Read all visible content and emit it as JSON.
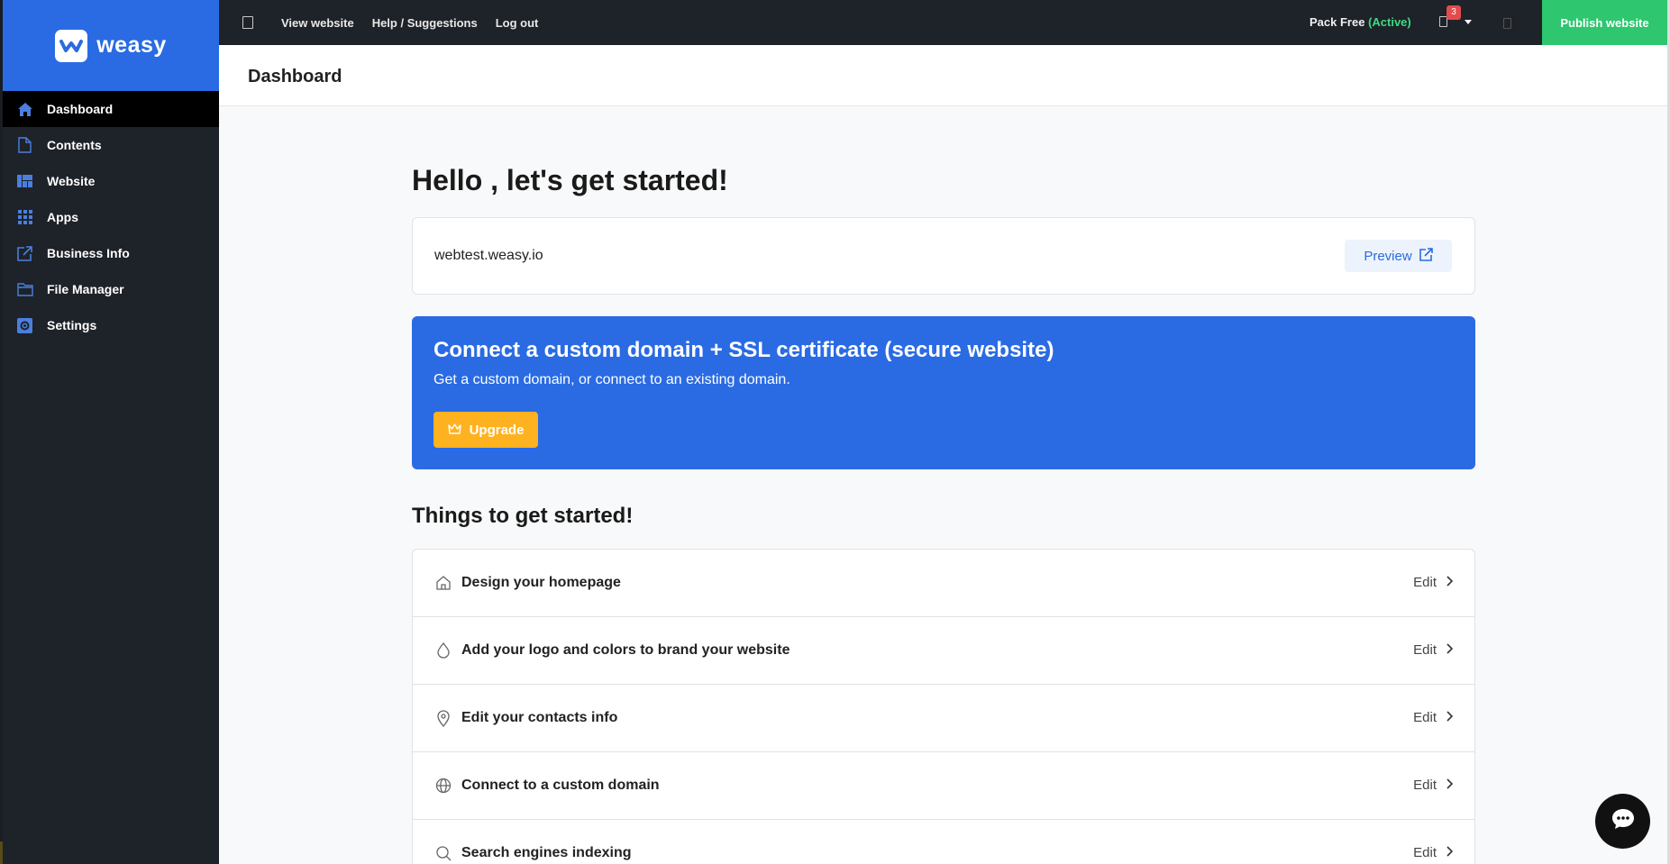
{
  "brand": {
    "name": "weasy",
    "color": "#2a6be3"
  },
  "sidebar": {
    "items": [
      {
        "label": "Dashboard",
        "icon": "home-icon",
        "active": true
      },
      {
        "label": "Contents",
        "icon": "document-icon"
      },
      {
        "label": "Website",
        "icon": "layout-icon"
      },
      {
        "label": "Apps",
        "icon": "grid-icon"
      },
      {
        "label": "Business Info",
        "icon": "external-edit-icon"
      },
      {
        "label": "File Manager",
        "icon": "folder-icon"
      },
      {
        "label": "Settings",
        "icon": "gear-icon"
      }
    ]
  },
  "topbar": {
    "links": [
      "View website",
      "Help / Suggestions",
      "Log out"
    ],
    "pack_label": "Pack Free",
    "pack_status": "(Active)",
    "notification_count": "3",
    "publish_label": "Publish website"
  },
  "page": {
    "title": "Dashboard"
  },
  "main": {
    "greeting": "Hello , let's get started!",
    "site_url": "webtest.weasy.io",
    "preview_label": "Preview",
    "promo": {
      "title": "Connect a custom domain + SSL certificate (secure website)",
      "subtitle": "Get a custom domain, or connect to an existing domain.",
      "button_label": "Upgrade"
    },
    "section_title": "Things to get started!",
    "tasks": [
      {
        "label": "Design your homepage",
        "icon": "home-outline-icon",
        "action": "Edit"
      },
      {
        "label": "Add your logo and colors to brand your website",
        "icon": "drop-icon",
        "action": "Edit"
      },
      {
        "label": "Edit your contacts info",
        "icon": "map-pin-icon",
        "action": "Edit"
      },
      {
        "label": "Connect to a custom domain",
        "icon": "globe-icon",
        "action": "Edit"
      },
      {
        "label": "Search engines indexing",
        "icon": "search-icon",
        "action": "Edit"
      }
    ]
  },
  "colors": {
    "sidebar_bg": "#1e2229",
    "publish": "#2ec66e",
    "upgrade": "#ffb21f",
    "active_green": "#3ddc84"
  }
}
